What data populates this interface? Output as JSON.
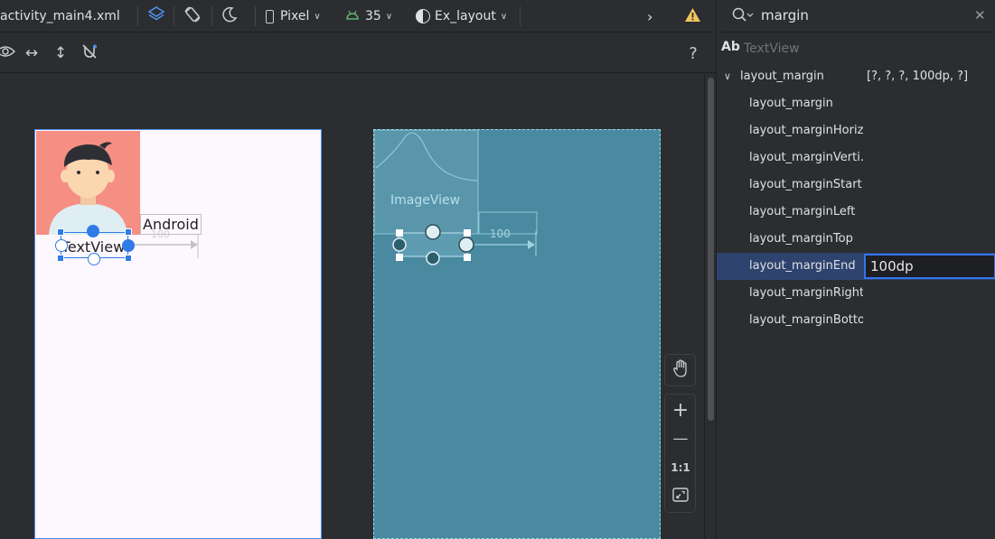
{
  "toolbar": {
    "file_tab": "activity_main4.xml",
    "device": "Pixel",
    "api_level": "35",
    "theme": "Ex_layout",
    "icons": {
      "design_mode": "layers-icon",
      "orientation": "rotate-device-icon",
      "night_mode": "moon-icon",
      "device": "phone-icon",
      "api": "android-icon",
      "theme": "contrast-circle-icon",
      "overflow": "chevron-right-icon",
      "warning": "warning-icon"
    },
    "warning_color": "#f2c55c"
  },
  "toolbar2": {
    "help": "?",
    "icons": [
      "eye-icon",
      "horizontal-arrows-icon",
      "vertical-arrows-icon",
      "constraint-magnet-off-icon"
    ]
  },
  "design": {
    "android_text": "Android",
    "textview_text": "TextView",
    "margin_value": "100",
    "avatar_bg": "#f58e83"
  },
  "blueprint": {
    "imageview_label": "ImageView",
    "margin_value": "100",
    "bg": "#4a8aa0"
  },
  "zoom_controls": {
    "pan": "hand-icon",
    "zoom_in": "+",
    "zoom_out": "—",
    "actual_size": "1:1",
    "fit": "fit-screen-icon"
  },
  "attributes": {
    "search_value": "margin",
    "component_label": "Ab",
    "component_type": "TextView",
    "group": {
      "name": "layout_margin",
      "value": "[?, ?, ?, 100dp, ?]"
    },
    "rows": [
      {
        "name": "layout_margin",
        "value": ""
      },
      {
        "name": "layout_marginHoriz…",
        "value": ""
      },
      {
        "name": "layout_marginVerti…",
        "value": ""
      },
      {
        "name": "layout_marginStart",
        "value": ""
      },
      {
        "name": "layout_marginLeft",
        "value": ""
      },
      {
        "name": "layout_marginTop",
        "value": ""
      },
      {
        "name": "layout_marginEnd",
        "value": "100dp"
      },
      {
        "name": "layout_marginRight",
        "value": ""
      },
      {
        "name": "layout_marginBotto…",
        "value": ""
      }
    ]
  }
}
